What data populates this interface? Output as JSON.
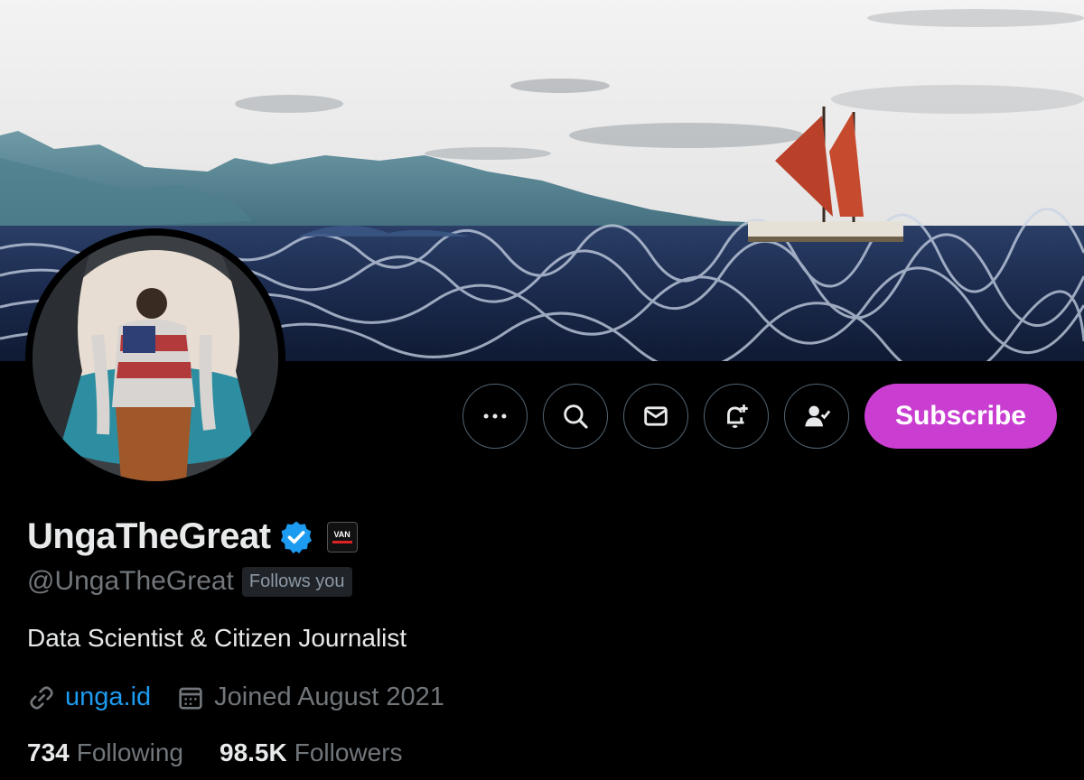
{
  "profile": {
    "display_name": "UngaTheGreat",
    "handle": "@UngaTheGreat",
    "follows_you": "Follows you",
    "bio": "Data Scientist & Citizen Journalist",
    "website": "unga.id",
    "joined": "Joined August 2021",
    "affiliate_badge": "VAN"
  },
  "stats": {
    "following_count": "734",
    "following_label": "Following",
    "followers_count": "98.5K",
    "followers_label": "Followers"
  },
  "actions": {
    "subscribe_label": "Subscribe"
  },
  "colors": {
    "subscribe": "#c93ed1",
    "link": "#1d9bf0",
    "verified": "#1d9bf0",
    "muted": "#71767b"
  },
  "icons": [
    "more-icon",
    "search-icon",
    "mail-icon",
    "notify-bell-icon",
    "following-user-icon",
    "verified-icon",
    "link-icon",
    "calendar-icon"
  ]
}
